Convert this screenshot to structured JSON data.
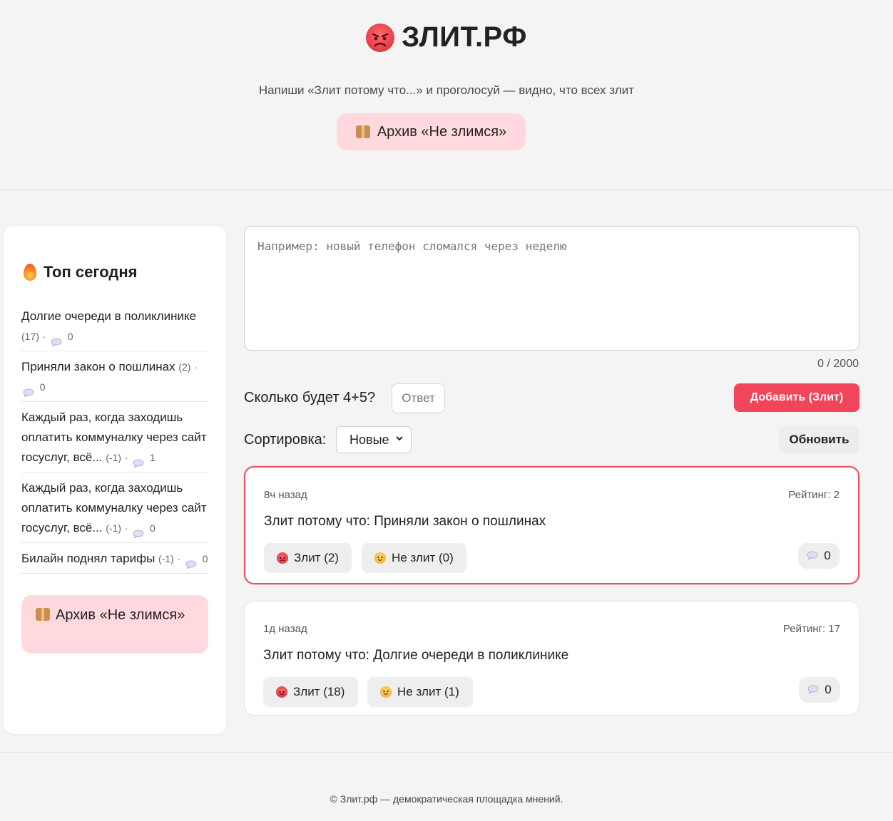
{
  "header": {
    "logo_icon": "angry-face-icon",
    "title": "ЗЛИТ.РФ",
    "tagline": "Напиши «Злит потому что...» и проголосуй — видно, что всех злит",
    "archive_label": "Архив «Не злимся»"
  },
  "sidebar": {
    "title": "Топ сегодня",
    "items": [
      {
        "text": "Долгие очереди в поликлинике",
        "score": "(17)",
        "sep": "·",
        "comments": "0"
      },
      {
        "text": "Приняли закон о пошлинах",
        "score": "(2)",
        "sep": "·",
        "comments": "0"
      },
      {
        "text": "Каждый раз, когда заходишь оплатить коммуналку через сайт госуслуг, всё...",
        "score": "(-1)",
        "sep": "·",
        "comments": "1"
      },
      {
        "text": "Каждый раз, когда заходишь оплатить коммуналку через сайт госуслуг, всё...",
        "score": "(-1)",
        "sep": "·",
        "comments": "0"
      },
      {
        "text": "Билайн поднял тарифы",
        "score": "(-1)",
        "sep": "·",
        "comments": "0"
      }
    ],
    "archive_label": "Архив «Не злимся»"
  },
  "composer": {
    "placeholder": "Например: новый телефон сломался через неделю",
    "counter": "0 / 2000",
    "captcha_question": "Сколько будет 4+5?",
    "captcha_placeholder": "Ответ",
    "add_label": "Добавить (Злит)"
  },
  "sort": {
    "label": "Сортировка:",
    "selected": "Новые",
    "refresh_label": "Обновить"
  },
  "posts": [
    {
      "time": "8ч назад",
      "rating": "Рейтинг: 2",
      "text": "Злит потому что: Приняли закон о пошлинах",
      "angry": "Злит (2)",
      "calm": "Не злит (0)",
      "comments": "0"
    },
    {
      "time": "1д назад",
      "rating": "Рейтинг: 17",
      "text": "Злит потому что: Долгие очереди в поликлинике",
      "angry": "Злит (18)",
      "calm": "Не злит (1)",
      "comments": "0"
    }
  ],
  "footer": {
    "text": "© Злит.рф — демократическая площадка мнений."
  },
  "colors": {
    "accent": "#f0455a",
    "archive_bg": "#ffd9dd",
    "highlight_border": "#ef5060"
  }
}
